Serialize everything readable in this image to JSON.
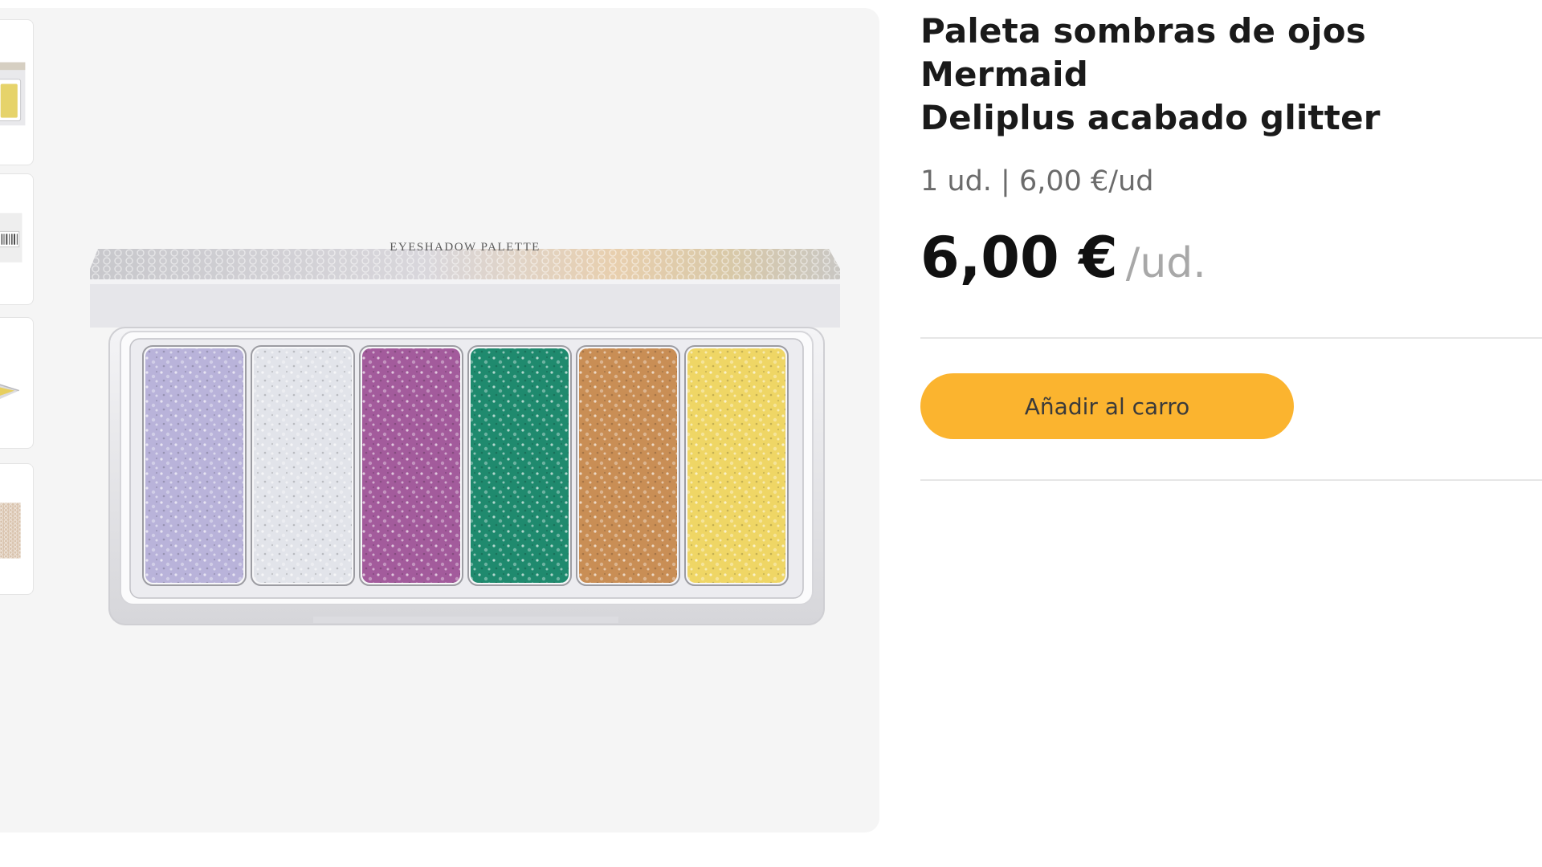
{
  "product": {
    "title_line1": "Paleta sombras de ojos Mermaid",
    "title_line2": "Deliplus acabado glitter",
    "unit_info": "1 ud. | 6,00 €/ud",
    "price": "6,00 €",
    "price_unit": "/ud.",
    "add_to_cart_label": "Añadir al carro",
    "palette_lid_text": "EYESHADOW PALETTE"
  },
  "thumbnails": [
    {
      "name": "palette-front-view",
      "selected": true
    },
    {
      "name": "palette-barcode-view",
      "selected": false
    },
    {
      "name": "palette-side-view",
      "selected": false
    },
    {
      "name": "palette-closed-view",
      "selected": false
    }
  ],
  "swatches": [
    {
      "name": "lilac",
      "color": "#b9b3da"
    },
    {
      "name": "silver",
      "color": "#e2e4ea"
    },
    {
      "name": "purple",
      "color": "#a35b9c"
    },
    {
      "name": "teal",
      "color": "#1f8a6e"
    },
    {
      "name": "bronze",
      "color": "#c98e55"
    },
    {
      "name": "gold",
      "color": "#efd665"
    }
  ],
  "colors": {
    "accent": "#fbb42f",
    "image_background": "#f5f5f5"
  }
}
